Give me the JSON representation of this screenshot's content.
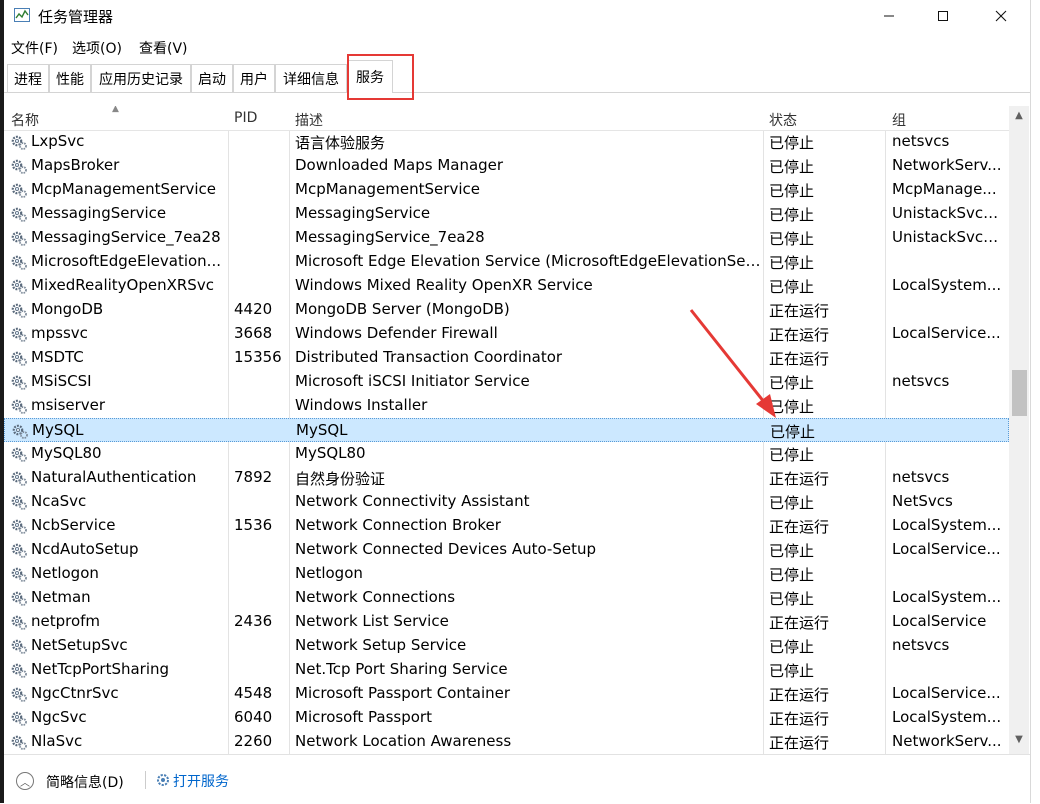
{
  "window": {
    "title": "任务管理器",
    "min_icon": "minimize-icon",
    "max_icon": "maximize-icon",
    "close_icon": "close-icon"
  },
  "menu": [
    "文件(F)",
    "选项(O)",
    "查看(V)"
  ],
  "tabs": [
    "进程",
    "性能",
    "应用历史记录",
    "启动",
    "用户",
    "详细信息",
    "服务"
  ],
  "active_tab": "服务",
  "columns": {
    "name": "名称",
    "pid": "PID",
    "desc": "描述",
    "status": "状态",
    "group": "组"
  },
  "rows": [
    {
      "name": "LxpSvc",
      "pid": "",
      "desc": "语言体验服务",
      "status": "已停止",
      "group": "netsvcs"
    },
    {
      "name": "MapsBroker",
      "pid": "",
      "desc": "Downloaded Maps Manager",
      "status": "已停止",
      "group": "NetworkServ..."
    },
    {
      "name": "McpManagementService",
      "pid": "",
      "desc": "McpManagementService",
      "status": "已停止",
      "group": "McpManage..."
    },
    {
      "name": "MessagingService",
      "pid": "",
      "desc": "MessagingService",
      "status": "已停止",
      "group": "UnistackSvcG..."
    },
    {
      "name": "MessagingService_7ea28",
      "pid": "",
      "desc": "MessagingService_7ea28",
      "status": "已停止",
      "group": "UnistackSvcG..."
    },
    {
      "name": "MicrosoftEdgeElevation...",
      "pid": "",
      "desc": "Microsoft Edge Elevation Service (MicrosoftEdgeElevationSer...",
      "status": "已停止",
      "group": ""
    },
    {
      "name": "MixedRealityOpenXRSvc",
      "pid": "",
      "desc": "Windows Mixed Reality OpenXR Service",
      "status": "已停止",
      "group": "LocalSystem..."
    },
    {
      "name": "MongoDB",
      "pid": "4420",
      "desc": "MongoDB Server (MongoDB)",
      "status": "正在运行",
      "group": ""
    },
    {
      "name": "mpssvc",
      "pid": "3668",
      "desc": "Windows Defender Firewall",
      "status": "正在运行",
      "group": "LocalService..."
    },
    {
      "name": "MSDTC",
      "pid": "15356",
      "desc": "Distributed Transaction Coordinator",
      "status": "正在运行",
      "group": ""
    },
    {
      "name": "MSiSCSI",
      "pid": "",
      "desc": "Microsoft iSCSI Initiator Service",
      "status": "已停止",
      "group": "netsvcs"
    },
    {
      "name": "msiserver",
      "pid": "",
      "desc": "Windows Installer",
      "status": "已停止",
      "group": ""
    },
    {
      "name": "MySQL",
      "pid": "",
      "desc": "MySQL",
      "status": "已停止",
      "group": "",
      "selected": true
    },
    {
      "name": "MySQL80",
      "pid": "",
      "desc": "MySQL80",
      "status": "已停止",
      "group": ""
    },
    {
      "name": "NaturalAuthentication",
      "pid": "7892",
      "desc": "自然身份验证",
      "status": "正在运行",
      "group": "netsvcs"
    },
    {
      "name": "NcaSvc",
      "pid": "",
      "desc": "Network Connectivity Assistant",
      "status": "已停止",
      "group": "NetSvcs"
    },
    {
      "name": "NcbService",
      "pid": "1536",
      "desc": "Network Connection Broker",
      "status": "正在运行",
      "group": "LocalSystem..."
    },
    {
      "name": "NcdAutoSetup",
      "pid": "",
      "desc": "Network Connected Devices Auto-Setup",
      "status": "已停止",
      "group": "LocalService..."
    },
    {
      "name": "Netlogon",
      "pid": "",
      "desc": "Netlogon",
      "status": "已停止",
      "group": ""
    },
    {
      "name": "Netman",
      "pid": "",
      "desc": "Network Connections",
      "status": "已停止",
      "group": "LocalSystem..."
    },
    {
      "name": "netprofm",
      "pid": "2436",
      "desc": "Network List Service",
      "status": "正在运行",
      "group": "LocalService"
    },
    {
      "name": "NetSetupSvc",
      "pid": "",
      "desc": "Network Setup Service",
      "status": "已停止",
      "group": "netsvcs"
    },
    {
      "name": "NetTcpPortSharing",
      "pid": "",
      "desc": "Net.Tcp Port Sharing Service",
      "status": "已停止",
      "group": ""
    },
    {
      "name": "NgcCtnrSvc",
      "pid": "4548",
      "desc": "Microsoft Passport Container",
      "status": "正在运行",
      "group": "LocalService..."
    },
    {
      "name": "NgcSvc",
      "pid": "6040",
      "desc": "Microsoft Passport",
      "status": "正在运行",
      "group": "LocalSystem..."
    },
    {
      "name": "NlaSvc",
      "pid": "2260",
      "desc": "Network Location Awareness",
      "status": "正在运行",
      "group": "NetworkServ..."
    }
  ],
  "footer": {
    "fewer_details": "简略信息(D)",
    "open_services": "打开服务"
  }
}
